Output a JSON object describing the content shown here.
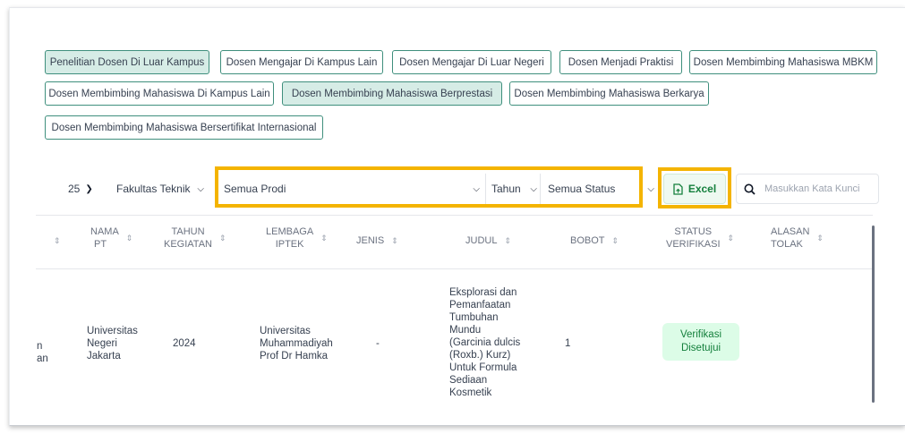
{
  "tabs": [
    {
      "label": "Penelitian Dosen Di Luar Kampus",
      "active": true
    },
    {
      "label": "Dosen Mengajar Di Kampus Lain",
      "active": false
    },
    {
      "label": "Dosen Mengajar Di Luar Negeri",
      "active": false
    },
    {
      "label": "Dosen Menjadi Praktisi",
      "active": false
    },
    {
      "label": "Dosen Membimbing Mahasiswa MBKM",
      "active": false
    },
    {
      "label": "Dosen Membimbing Mahasiswa Di Kampus Lain",
      "active": false
    },
    {
      "label": "Dosen Membimbing Mahasiswa Berprestasi",
      "active": true
    },
    {
      "label": "Dosen Membimbing Mahasiswa Berkarya",
      "active": false
    },
    {
      "label": "Dosen Membimbing Mahasiswa Bersertifikat Internasional",
      "active": false
    }
  ],
  "filters": {
    "per_page": "25",
    "fakultas": "Fakultas Teknik",
    "prodi": "Semua Prodi",
    "tahun": "Tahun",
    "status": "Semua Status",
    "excel_label": "Excel",
    "search_placeholder": "Masukkan Kata Kunci"
  },
  "table": {
    "headers": {
      "nama_pt": [
        "NAMA",
        "PT"
      ],
      "tahun": [
        "TAHUN",
        "KEGIATAN"
      ],
      "lembaga": [
        "LEMBAGA",
        "IPTEK"
      ],
      "jenis": "JENIS",
      "judul": "JUDUL",
      "bobot": "BOBOT",
      "status": [
        "STATUS",
        "VERIFIKASI"
      ],
      "alasan": [
        "ALASAN",
        "TOLAK"
      ]
    },
    "row": {
      "left_fragment": [
        "n",
        "an"
      ],
      "nama_pt": [
        "Universitas",
        "Negeri",
        "Jakarta"
      ],
      "tahun": "2024",
      "lembaga": [
        "Universitas",
        "Muhammadiyah",
        "Prof Dr Hamka"
      ],
      "jenis": "-",
      "judul": [
        "Eksplorasi dan",
        "Pemanfaatan",
        "Tumbuhan",
        "Mundu",
        "(Garcinia dulcis",
        "(Roxb.) Kurz)",
        "Untuk Formula",
        "Sediaan",
        "Kosmetik"
      ],
      "bobot": "1",
      "status": [
        "Verifikasi",
        "Disetujui"
      ]
    }
  },
  "colors": {
    "highlight": "#f4b400",
    "tab_border": "#3f8f7d",
    "tab_active_bg": "#d6ece6",
    "excel_green": "#15803d",
    "badge_bg": "#dcfce7"
  }
}
